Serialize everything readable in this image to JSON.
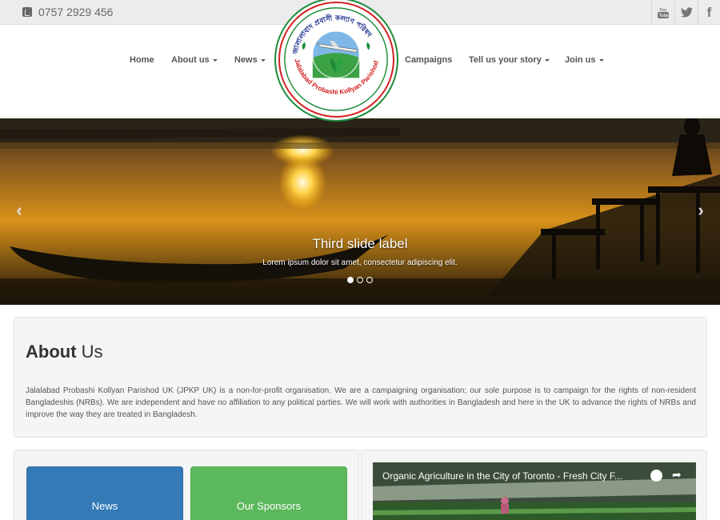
{
  "topbar": {
    "phone": "0757 2929 456",
    "social": [
      {
        "icon": "youtube-icon",
        "label": "You Tube"
      },
      {
        "icon": "twitter-icon",
        "label": "🐦"
      },
      {
        "icon": "facebook-icon",
        "label": "f"
      }
    ]
  },
  "nav": {
    "home": "Home",
    "about": "About us",
    "news": "News",
    "campaigns": "Campaigns",
    "story": "Tell us your story",
    "join": "Join us"
  },
  "logo": {
    "name": "Jalalabad Probashi Kollyan Parishod",
    "bangla": "জালালাবাদ প্রবাসী কল্যাণ পরিষদ"
  },
  "carousel": {
    "title": "Third slide label",
    "text": "Lorem ipsum dolor sit amet, consectetur adipiscing elit.",
    "prev": "‹",
    "next": "›",
    "slides": 3,
    "active": 1
  },
  "about": {
    "title_bold": "About",
    "title_rest": " Us",
    "text": "Jalalabad Probashi Kollyan Parishod UK (JPKP UK) is a non-for-profit organisation. We are a campaigning organisation; our sole purpose is to campaign for the rights of non-resident Bangladeshis (NRBs). We are independent and have no affiliation to any political parties. We will work with authorities in Bangladesh and here in the UK to advance the rights of NRBs and improve the way they are treated in Bangladesh."
  },
  "tiles": {
    "news": "News",
    "sponsors": "Our Sponsors"
  },
  "video": {
    "title": "Organic Agriculture in the City of Toronto - Fresh City F..."
  },
  "colors": {
    "news_tile": "#337ab7",
    "sponsor_tile": "#5cb85c",
    "logo_red": "#d32020",
    "logo_green": "#1e8c3a"
  }
}
